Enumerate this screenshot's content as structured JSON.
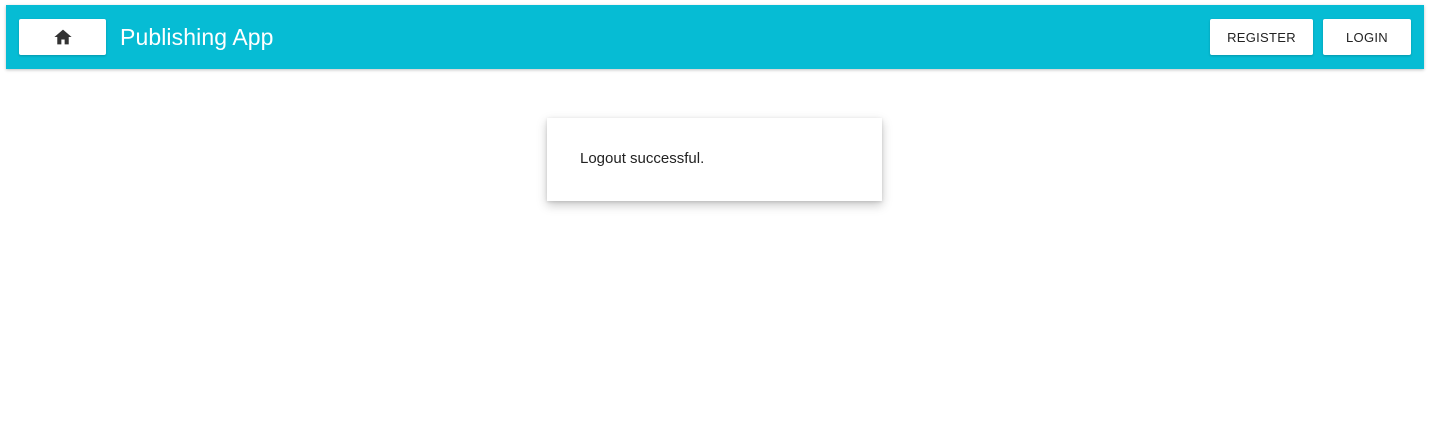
{
  "app_bar": {
    "title": "Publishing App",
    "home_icon": "home-icon",
    "background_color": "#06bcd4",
    "register_label": "REGISTER",
    "login_label": "LOGIN"
  },
  "main": {
    "message": "Logout successful."
  }
}
